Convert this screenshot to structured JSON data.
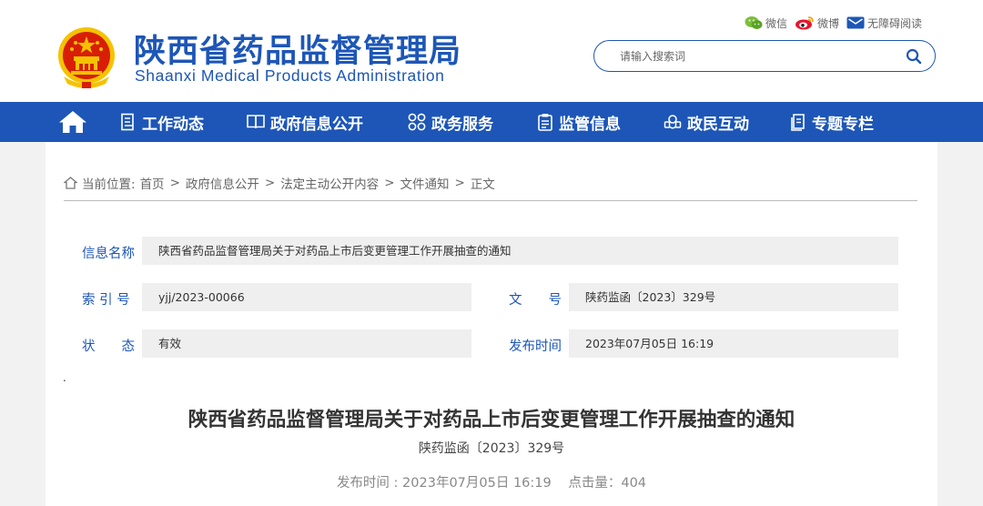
{
  "header": {
    "title_cn": "陕西省药品监督管理局",
    "title_en": "Shaanxi Medical Products Administration",
    "links": [
      {
        "label": "微信",
        "icon": "wechat-icon"
      },
      {
        "label": "微博",
        "icon": "weibo-icon"
      },
      {
        "label": "无障碍阅读",
        "icon": "accessibility-icon"
      }
    ],
    "search": {
      "placeholder": "请输入搜索词",
      "value": ""
    }
  },
  "nav": {
    "items": [
      {
        "label": "工作动态",
        "icon": "document-list-icon"
      },
      {
        "label": "政府信息公开",
        "icon": "book-icon"
      },
      {
        "label": "政务服务",
        "icon": "grid-icon"
      },
      {
        "label": "监管信息",
        "icon": "clipboard-icon"
      },
      {
        "label": "政民互动",
        "icon": "interaction-icon"
      },
      {
        "label": "专题专栏",
        "icon": "folder-icon"
      }
    ]
  },
  "breadcrumb": {
    "prefix": "当前位置:",
    "items": [
      "首页",
      "政府信息公开",
      "法定主动公开内容",
      "文件通知",
      "正文"
    ]
  },
  "meta": {
    "info_name_label": "信息名称",
    "info_name_value": "陕西省药品监督管理局关于对药品上市后变更管理工作开展抽查的通知",
    "index_label": "索 引 号",
    "index_value": "yjj/2023-00066",
    "docno_label": "文　　号",
    "docno_value": "陕药监函〔2023〕329号",
    "status_label": "状　　态",
    "status_value": "有效",
    "date_label": "发布时间",
    "date_value": "2023年07月05日 16:19"
  },
  "article": {
    "dot": ".",
    "title": "陕西省药品监督管理局关于对药品上市后变更管理工作开展抽查的通知",
    "doc_number": "陕药监函〔2023〕329号",
    "publish_time": "发布时间 : 2023年07月05日 16:19",
    "clicks": "点击量：404"
  },
  "colors": {
    "brand": "#1d56b7",
    "emblem_red": "#d81e06",
    "emblem_gold": "#f5c200"
  }
}
